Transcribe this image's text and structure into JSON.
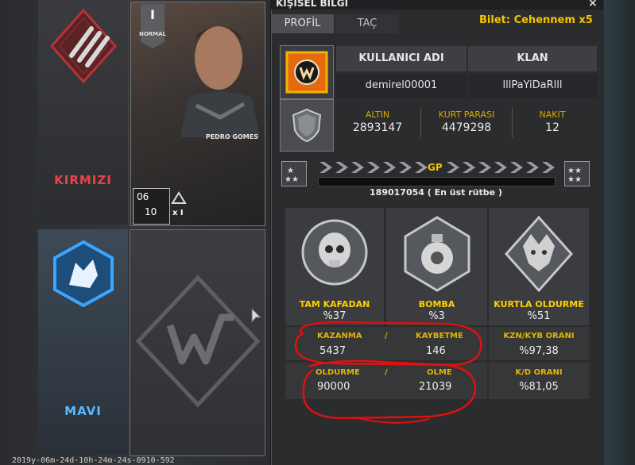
{
  "team_red": {
    "label": "KIRMIZI",
    "color": "#e8434a"
  },
  "team_blue": {
    "label": "MAVI",
    "color": "#4fb6ff"
  },
  "player_card": {
    "rank_numeral": "I",
    "mode": "NORMAL",
    "name": "PEDRO GOMES",
    "count_top": "06",
    "count_bottom": "10",
    "multiplier": "x I"
  },
  "timestamp": "2019y-06m-24d-10h-24m-24s-0910-592",
  "window": {
    "title": "KIŞISEL BILGI",
    "close": "×"
  },
  "tabs": [
    {
      "label": "PROFİL"
    },
    {
      "label": "TAÇ"
    }
  ],
  "ticket": "Bilet: Cehennem x5",
  "profile": {
    "username_header": "KULLANICI ADI",
    "clan_header": "KLAN",
    "username": "demirel00001",
    "clan": "lllPaYiDaRlll"
  },
  "currency": {
    "gold_label": "ALTIN",
    "gold_value": "2893147",
    "wolf_label": "KURT PARASI",
    "wolf_value": "4479298",
    "cash_label": "NAKIT",
    "cash_value": "12"
  },
  "gp": {
    "label": "GP",
    "progress": 1.0,
    "text": "189017054 ( En üst rütbe )"
  },
  "stats": [
    {
      "name": "TAM KAFADAN",
      "value": "%37"
    },
    {
      "name": "BOMBA",
      "value": "%3"
    },
    {
      "name": "KURTLA OLDURME",
      "value": "%51"
    }
  ],
  "win_row": {
    "win_label": "KAZANMA",
    "slash": "/",
    "lose_label": "KAYBETME",
    "win_value": "5437",
    "lose_value": "146",
    "ratio_label": "KZN/KYB ORANI",
    "ratio_value": "%97,38"
  },
  "kill_row": {
    "kill_label": "OLDURME",
    "slash": "/",
    "death_label": "OLME",
    "kill_value": "90000",
    "death_value": "21039",
    "ratio_label": "K/D ORANI",
    "ratio_value": "%81,05"
  },
  "colors": {
    "accent_gold": "#f2c400",
    "annotation_red": "#e01010"
  }
}
